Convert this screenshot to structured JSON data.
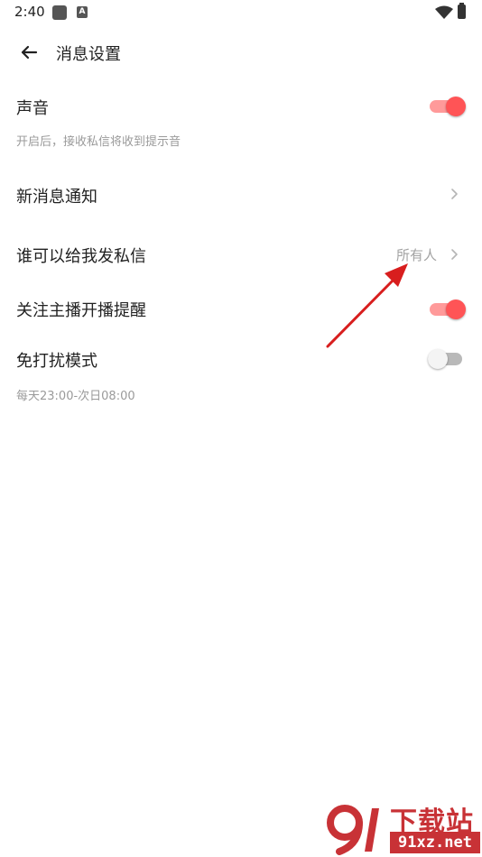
{
  "status_bar": {
    "time": "2:40",
    "notif_icon_letter": "A"
  },
  "header": {
    "title": "消息设置",
    "back_icon": "arrow-left-icon"
  },
  "settings": {
    "sound": {
      "label": "声音",
      "description": "开启后，接收私信将收到提示音",
      "enabled": true
    },
    "new_message_notification": {
      "label": "新消息通知"
    },
    "who_can_message": {
      "label": "谁可以给我发私信",
      "value": "所有人"
    },
    "follow_live_reminder": {
      "label": "关注主播开播提醒",
      "enabled": true
    },
    "do_not_disturb": {
      "label": "免打扰模式",
      "description": "每天23:00-次日08:00",
      "enabled": false
    }
  },
  "watermark": {
    "top_text": "下载站",
    "bottom_text": "91xz.net"
  },
  "colors": {
    "accent": "#ff5456",
    "accent_track": "#ff9a9a",
    "annotation_arrow": "#d81e1e",
    "watermark": "#c83236"
  }
}
